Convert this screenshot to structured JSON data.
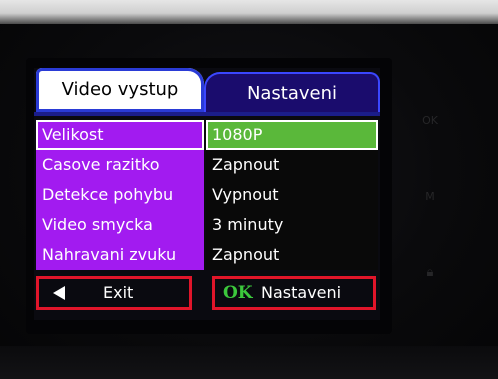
{
  "tabs": {
    "active_label": "Video vystup",
    "inactive_label": "Nastaveni"
  },
  "menu": [
    {
      "label": "Velikost",
      "value": "1080P",
      "selected": true
    },
    {
      "label": "Casove razitko",
      "value": "Zapnout",
      "selected": false
    },
    {
      "label": "Detekce pohybu",
      "value": "Vypnout",
      "selected": false
    },
    {
      "label": "Video smycka",
      "value": "3 minuty",
      "selected": false
    },
    {
      "label": "Nahravani zvuku",
      "value": "Zapnout",
      "selected": false
    }
  ],
  "footer": {
    "exit_label": "Exit",
    "ok_key": "OK",
    "confirm_label": "Nastaveni"
  },
  "hardware_buttons": {
    "ok": "OK",
    "mode": "M"
  },
  "colors": {
    "label_bg": "#a21bf0",
    "selected_value_bg": "#5ab83a",
    "inactive_tab_bg": "#1a0c6d",
    "footer_border": "#e0152a",
    "ok_text": "#3cc83c"
  }
}
